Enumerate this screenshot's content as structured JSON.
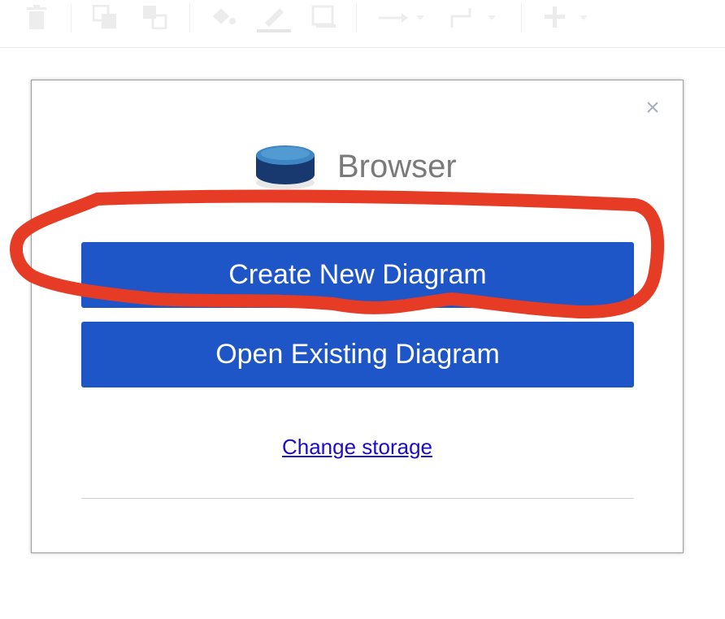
{
  "toolbar": {
    "icons": [
      "trash-icon",
      "to-front-icon",
      "to-back-icon",
      "fill-color-icon",
      "line-color-icon",
      "shadow-icon",
      "connection-icon",
      "waypoints-icon",
      "insert-icon"
    ]
  },
  "dialog": {
    "close_label": "×",
    "storage_title": "Browser",
    "create_button": "Create New Diagram",
    "open_button": "Open Existing Diagram",
    "change_storage_link": "Change storage"
  },
  "colors": {
    "button_bg": "#1f56c7",
    "link": "#1a0dcc",
    "annotation": "#e63b25"
  }
}
